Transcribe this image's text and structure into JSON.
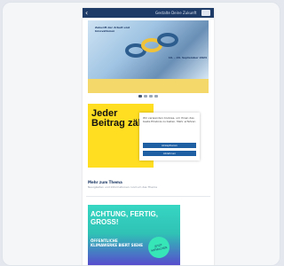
{
  "topbar": {
    "title": "Gestalte Deine Zukunft",
    "back_icon": "chevron-left-icon",
    "menu_icon": "menu-icon"
  },
  "hero": {
    "title": "Zukunft der Arbeit und Innovationen",
    "date": "16. – 20. September 2024"
  },
  "carousel": {
    "dots": 4,
    "active_index": 0
  },
  "promo": {
    "text": "Jeder Beitrag zählt!"
  },
  "cookie": {
    "text": "Wir verwenden Cookies, um Ihnen das beste Erlebnis zu bieten. Mehr erfahren",
    "accept_label": "Akzeptieren",
    "decline_label": "Ablehnen"
  },
  "section": {
    "title": "Mehr zum Thema",
    "subtitle": "Neuigkeiten und Informationen rund um das Thema"
  },
  "ad": {
    "headline": "ACHTUNG, FERTIG, GROSS!",
    "subline": "ÖFFENTLICHE KLIMAWERKE BIERT SIEHE",
    "badge": "JETZT MITMACHEN"
  },
  "colors": {
    "background": "#e4e8ee",
    "topbar": "#1e3a66",
    "promo": "#ffde21",
    "accent": "#1e5fa3"
  }
}
